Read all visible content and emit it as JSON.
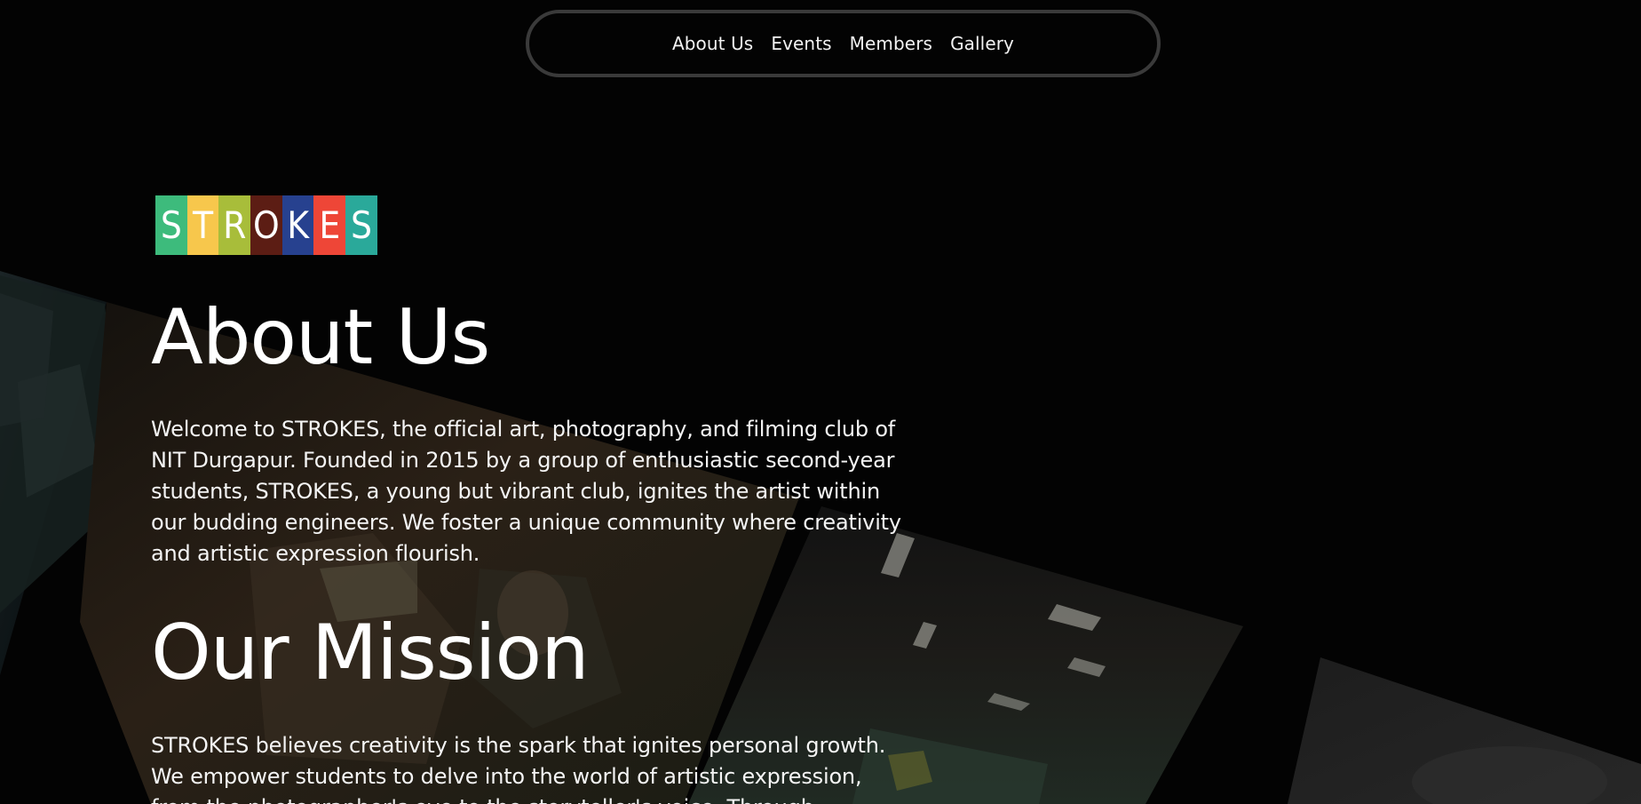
{
  "nav": {
    "links": [
      "About Us",
      "Events",
      "Members",
      "Gallery"
    ]
  },
  "logo": {
    "letters": [
      "S",
      "T",
      "R",
      "O",
      "K",
      "E",
      "S"
    ],
    "colors": [
      "#3dbb7c",
      "#f7c74c",
      "#a8bd3a",
      "#5c1d14",
      "#27418f",
      "#ee4637",
      "#2aa99a"
    ]
  },
  "about": {
    "title": "About Us",
    "text": "Welcome to STROKES, the official art, photography, and filming club of NIT Durgapur. Founded in 2015 by a group of enthusiastic second-year students, STROKES, a young but vibrant club, ignites the artist within our budding engineers. We foster a unique community where creativity and artistic expression flourish."
  },
  "mission": {
    "title": "Our Mission",
    "text": "STROKES believes creativity is the spark that ignites personal growth. We empower students to delve into the world of artistic expression, from the photographer's eye to the storyteller's voice. Through"
  },
  "colors": {
    "background": "#030303",
    "nav_border": "#3a3a3a",
    "text": "#ffffff"
  }
}
